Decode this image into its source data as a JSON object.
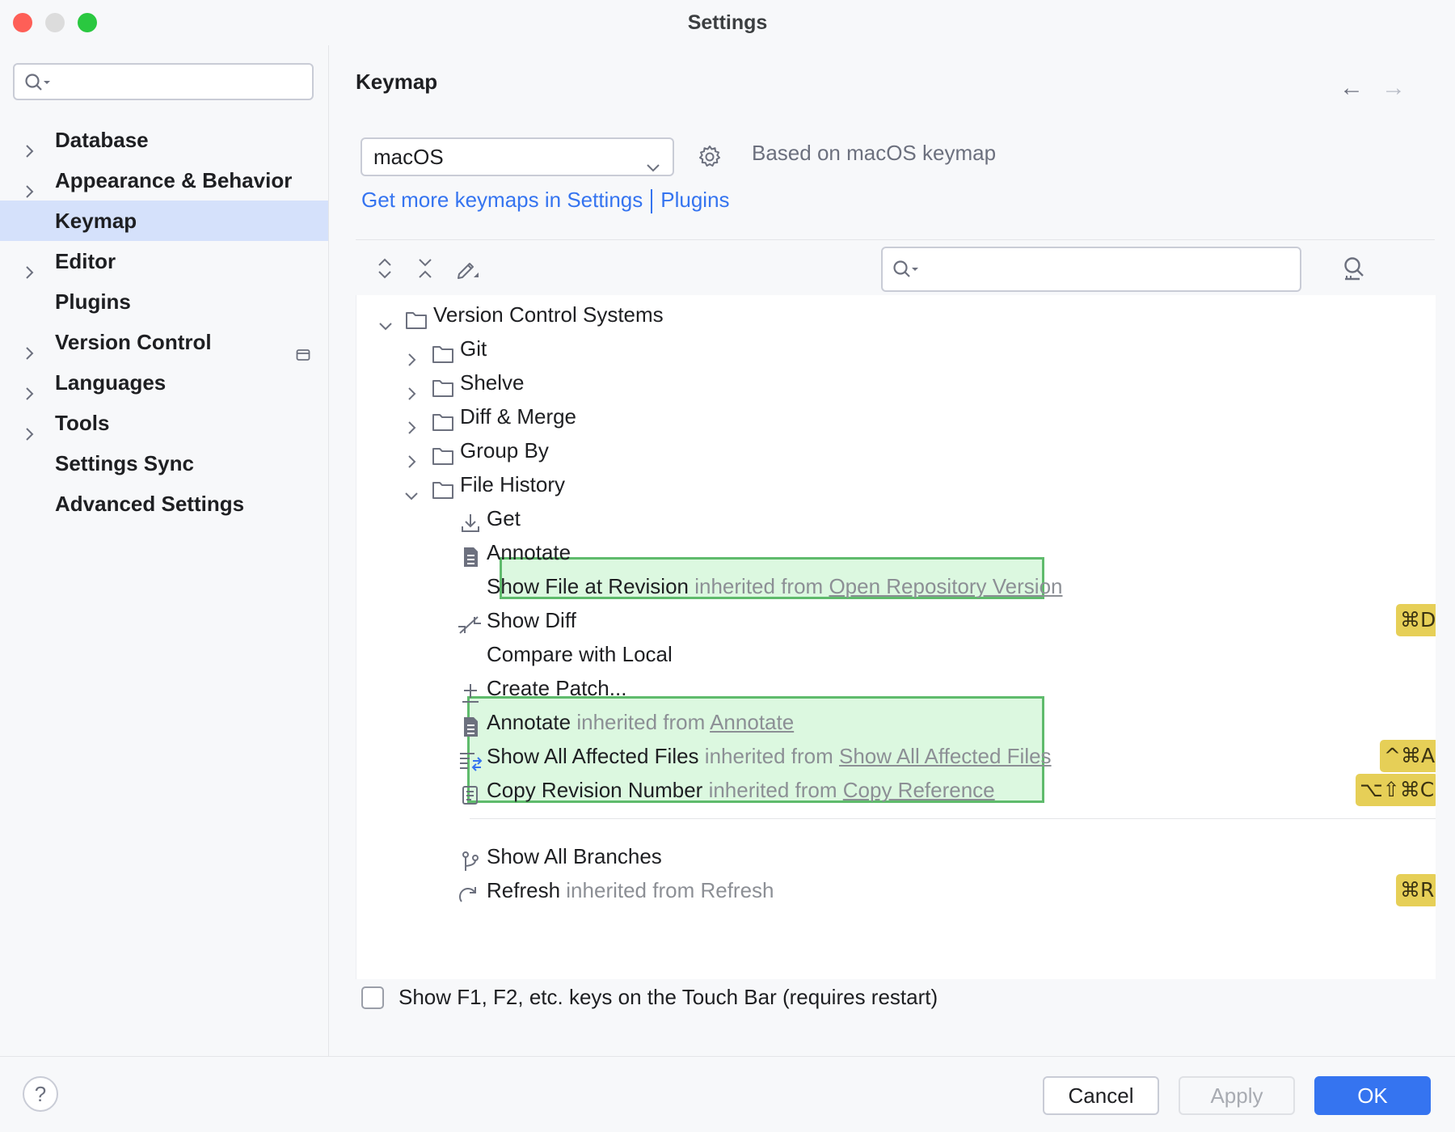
{
  "window": {
    "title": "Settings"
  },
  "sidebar": {
    "search_placeholder": "",
    "items": [
      {
        "label": "Database",
        "expandable": true
      },
      {
        "label": "Appearance & Behavior",
        "expandable": true
      },
      {
        "label": "Keymap",
        "expandable": false,
        "selected": true
      },
      {
        "label": "Editor",
        "expandable": true
      },
      {
        "label": "Plugins",
        "expandable": false
      },
      {
        "label": "Version Control",
        "expandable": true
      },
      {
        "label": "Languages",
        "expandable": true
      },
      {
        "label": "Tools",
        "expandable": true
      },
      {
        "label": "Settings Sync",
        "expandable": false
      },
      {
        "label": "Advanced Settings",
        "expandable": false
      }
    ]
  },
  "main": {
    "title": "Keymap",
    "keymap_select": "macOS",
    "based_on": "Based on macOS keymap",
    "link_settings": "Get more keymaps in Settings",
    "link_plugins": "Plugins",
    "search_placeholder": ""
  },
  "tree": {
    "version_control_systems": "Version Control Systems",
    "git": "Git",
    "shelve": "Shelve",
    "diff_merge": "Diff & Merge",
    "group_by": "Group By",
    "file_history": "File History",
    "get": "Get",
    "annotate": "Annotate",
    "show_file_at_revision": "Show File at Revision",
    "show_file_inh": "inherited from",
    "show_file_src": "Open Repository Version",
    "show_diff": "Show Diff",
    "show_diff_key": "⌘D",
    "compare_with_local": "Compare with Local",
    "create_patch": "Create Patch...",
    "annotate2": "Annotate",
    "annotate2_inh": "inherited from",
    "annotate2_src": "Annotate",
    "show_all_affected": "Show All Affected Files",
    "show_all_affected_inh": "inherited from",
    "show_all_affected_src": "Show All Affected Files",
    "show_all_affected_key": "^⌘A",
    "copy_revision": "Copy Revision Number",
    "copy_revision_inh": "inherited from",
    "copy_revision_src": "Copy Reference",
    "copy_revision_key": "⌥⇧⌘C",
    "show_all_branches": "Show All Branches",
    "refresh": "Refresh",
    "refresh_inh": "inherited from Refresh",
    "refresh_key": "⌘R"
  },
  "touchbar": {
    "label": "Show F1, F2, etc. keys on the Touch Bar (requires restart)",
    "checked": false
  },
  "footer": {
    "help": "?",
    "cancel": "Cancel",
    "apply": "Apply",
    "ok": "OK"
  },
  "colors": {
    "accent": "#3574f0",
    "selection": "#d5e1fb",
    "highlight_bg": "#dcf8e0",
    "highlight_border": "#5fbb6c",
    "shortcut_bg": "#e6cf57"
  }
}
